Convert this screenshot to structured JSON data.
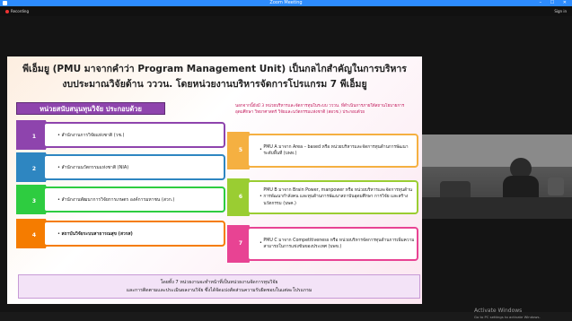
{
  "window": {
    "title": "Zoom Meeting",
    "controls": "– ☐ ✕"
  },
  "toolbar": {
    "recording_label": "Recording",
    "sign_in_label": "Sign in"
  },
  "slide": {
    "title_line1": "พีเอ็มยู (PMU มาจากคำว่า Program Management Unit) เป็นกลไกสำคัญในการบริหาร",
    "title_line2": "งบประมาณวิจัยด้าน วววน. โดยหน่วยงานบริหารจัดการโปรแกรม 7 พีเอ็มยู",
    "subheading": "หน่วยสนับสนุนทุนวิจัย ประกอบด้วย",
    "right_note": "นอกจากนี้ยังมี 3 หน่วยบริหารและจัดการทุนในระบบ วววน. ที่ดำเนินการภายใต้สถานโยบายการอุดมศึกษา วิทยาศาสตร์ วิจัยและนวัตกรรมแห่งชาติ (สอวช.) ประกอบด้วย",
    "left_items": [
      {
        "num": "1",
        "text": "สำนักงานการวิจัยแห่งชาติ (วช.)",
        "color": "#8e44ad",
        "bold": false
      },
      {
        "num": "2",
        "text": "สำนักงานนวัตกรรมแห่งชาติ (NIA)",
        "color": "#2e86c1",
        "bold": false
      },
      {
        "num": "3",
        "text": "สำนักงานพัฒนาการวิจัยการเกษตร องค์การมหาชน (สวก.)",
        "color": "#2ecc40",
        "bold": false
      },
      {
        "num": "4",
        "text": "สถาบันวิจัยระบบสาธารณสุข (สวรส)",
        "color": "#f57c00",
        "bold": true
      }
    ],
    "right_items": [
      {
        "num": "5",
        "text": "PMU A มาจาก Area – based หรือ หน่วยบริหารและจัดการทุนด้านการพัฒนาระดับพื้นที่ (บพท.)",
        "color": "#f5b041"
      },
      {
        "num": "6",
        "text": "PMU B มาจาก Brain Power, manpower หรือ หน่วยบริหารและจัดการทุนด้านการพัฒนากำลังคน และทุนด้านการพัฒนาสถาบันอุดมศึกษา การวิจัย และสร้างนวัตกรรม (บพค.)",
        "color": "#9acd32"
      },
      {
        "num": "7",
        "text": "PMU C มาจาก Competitiveness หรือ หน่วยบริหารจัดการทุนด้านการเพิ่มความสามารถในการแข่งขันของประเทศ (บพข.)",
        "color": "#e84393"
      }
    ],
    "footer_line1": "โดยทั้ง 7 หน่วยงานจะทำหน้าที่เป็นหน่วยงานจัดการทุนวิจัย",
    "footer_line2": "และการติดตามและประเมินผลงานวิจัย ซึ่งได้จัดแบ่งสัดส่วนความรับผิดชอบในแต่ละโปรแกรม"
  },
  "windows_watermark": {
    "line1": "Activate Windows",
    "line2": "Go to PC settings to activate Windows."
  }
}
